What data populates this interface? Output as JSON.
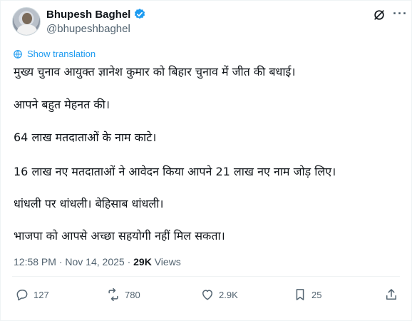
{
  "author": {
    "name": "Bhupesh Baghel",
    "handle": "@bhupeshbaghel"
  },
  "translate_label": "Show translation",
  "tweet_lines": [
    "मुख्य चुनाव आयुक्त ज्ञानेश कुमार को बिहार चुनाव में जीत की बधाई।",
    "आपने बहुत मेहनत की।",
    "64 लाख मतदाताओं के नाम काटे।",
    "16 लाख नए मतदाताओं ने आवेदन किया आपने 21 लाख नए नाम जोड़ लिए।",
    "धांधली पर धांधली। बेहिसाब धांधली।",
    "भाजपा को आपसे अच्छा सहयोगी नहीं मिल सकता।"
  ],
  "meta": {
    "time": "12:58 PM",
    "sep": " · ",
    "date": "Nov 14, 2025",
    "sep2": " · ",
    "views_count": "29K",
    "views_label": "Views"
  },
  "actions": {
    "replies": "127",
    "reposts": "780",
    "likes": "2.9K",
    "bookmarks": "25"
  },
  "colors": {
    "accent": "#1d9bf0",
    "text": "#0f1419",
    "muted": "#536471"
  },
  "icons": [
    "verified-badge-icon",
    "grok-icon",
    "more-icon",
    "translate-icon",
    "reply-icon",
    "repost-icon",
    "like-icon",
    "bookmark-icon",
    "share-icon"
  ]
}
